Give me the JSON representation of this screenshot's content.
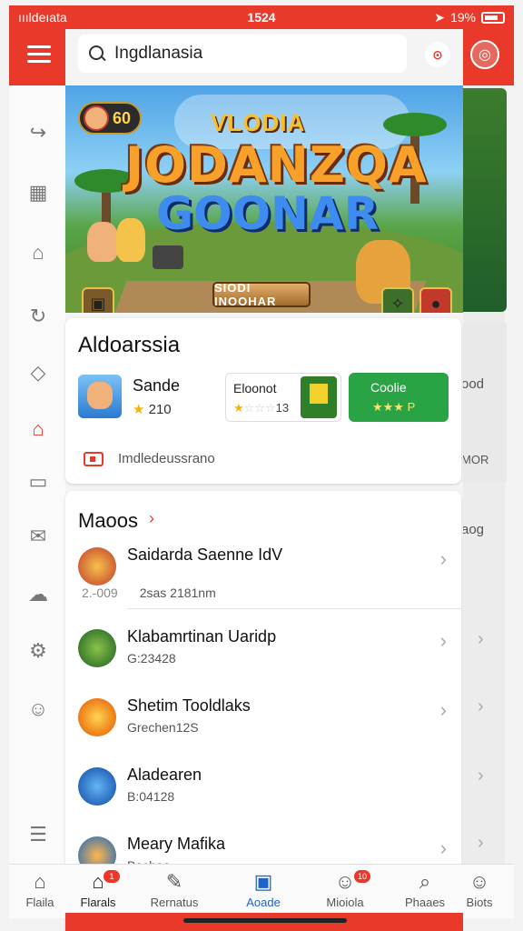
{
  "status": {
    "carrier": "ıııldeıata",
    "time": "1524",
    "battery": "19%"
  },
  "search": {
    "value": "Ingdlanasia"
  },
  "banner": {
    "coins": "60",
    "title_small": "VLODIA",
    "title_big": "JODANZQA",
    "title_sub": "GOONAR",
    "cta": "SIODI INOOHAR"
  },
  "featured": {
    "title": "Aldoarssia",
    "app1": {
      "name": "Sande",
      "rating": "210"
    },
    "app2": {
      "name": "Eloonot",
      "rating": "13"
    },
    "app3": {
      "name": "Coolie"
    },
    "footer": "Imdledeussrano"
  },
  "list": {
    "title": "Maoos",
    "rows": [
      {
        "name": "Saidarda Saenne IdV",
        "sub": "2sas 2181nm",
        "prefix": "2.-009"
      },
      {
        "name": "Klabamrtinan Uaridp",
        "sub": "G:23428"
      },
      {
        "name": "Shetim Tooldlaks",
        "sub": "Grechen12S"
      },
      {
        "name": "Aladearen",
        "sub": "B:04128"
      },
      {
        "name": "Meary Mafika",
        "sub": "Bachaa"
      }
    ]
  },
  "side": {
    "texts": [
      "ood",
      "MOR",
      "aog"
    ]
  },
  "nav": {
    "items": [
      {
        "label": "Flaila"
      },
      {
        "label": "Flarals",
        "badge": "1"
      },
      {
        "label": "Rernatus"
      },
      {
        "label": "Aoade"
      },
      {
        "label": "Mioiola",
        "badge": "10"
      },
      {
        "label": "Phaaes"
      },
      {
        "label": "Biots"
      }
    ]
  },
  "colors": {
    "brand": "#e8392b",
    "accent": "#1e63c6",
    "green": "#2aa344"
  }
}
